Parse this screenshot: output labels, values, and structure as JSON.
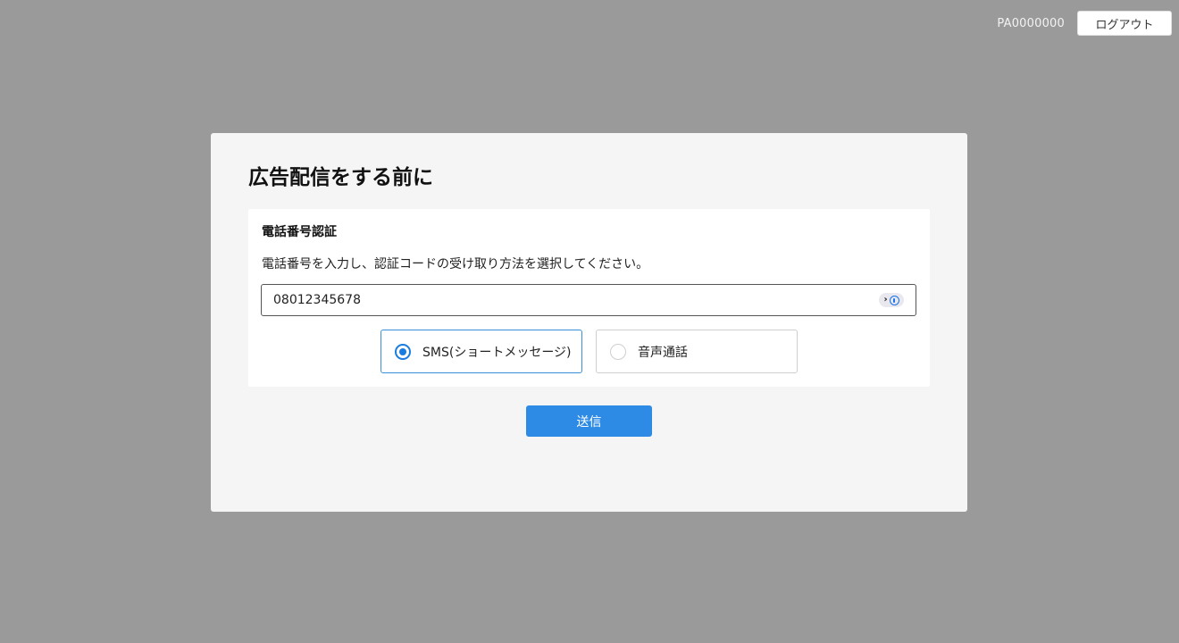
{
  "header": {
    "account_id": "PA0000000",
    "logout_label": "ログアウト"
  },
  "modal": {
    "title": "広告配信をする前に",
    "section": {
      "title": "電話番号認証",
      "description": "電話番号を入力し、認証コードの受け取り方法を選択してください。",
      "phone_input": {
        "value": "08012345678",
        "placeholder": ""
      },
      "options": [
        {
          "label": "SMS(ショートメッセージ)",
          "selected": true
        },
        {
          "label": "音声通話",
          "selected": false
        }
      ]
    },
    "submit_label": "送信"
  },
  "colors": {
    "overlay": "#9a9a9a",
    "accent": "#2d8be6",
    "radio_selected": "#1a7ce0"
  }
}
